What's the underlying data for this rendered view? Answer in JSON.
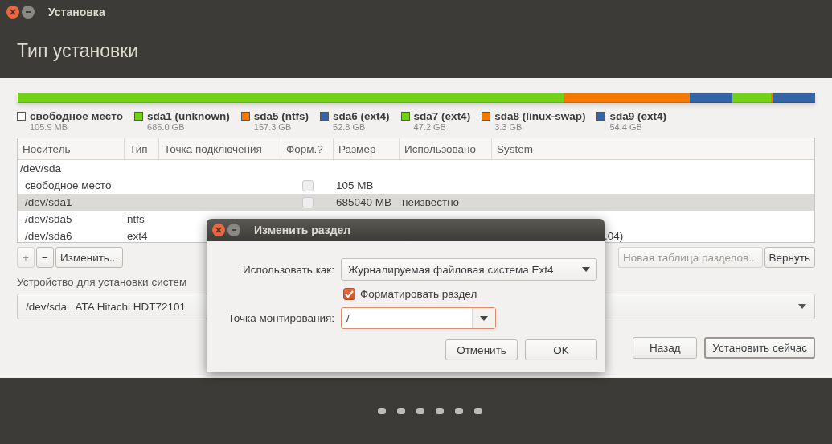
{
  "window": {
    "title": "Установка"
  },
  "page_title": "Тип установки",
  "partitions": [
    {
      "name": "свободное место",
      "size": "105.9 MB",
      "color": "#ffffff"
    },
    {
      "name": "sda1 (unknown)",
      "size": "685.0 GB",
      "color": "#73d216"
    },
    {
      "name": "sda5 (ntfs)",
      "size": "157.3 GB",
      "color": "#f57900"
    },
    {
      "name": "sda6 (ext4)",
      "size": "52.8 GB",
      "color": "#3465a4"
    },
    {
      "name": "sda7 (ext4)",
      "size": "47.2 GB",
      "color": "#73d216"
    },
    {
      "name": "sda8 (linux-swap)",
      "size": "3.3 GB",
      "color": "#f57900"
    },
    {
      "name": "sda9 (ext4)",
      "size": "54.4 GB",
      "color": "#3465a4"
    }
  ],
  "table": {
    "columns": [
      "Носитель",
      "Тип",
      "Точка подключения",
      "Форм.?",
      "Размер",
      "Использовано",
      "System"
    ],
    "rows": [
      {
        "kind": "disk",
        "device": "/dev/sda",
        "selected": false
      },
      {
        "kind": "partition",
        "device": "свободное место",
        "format": false,
        "size": "105 MB",
        "selected": false
      },
      {
        "kind": "partition",
        "device": "/dev/sda1",
        "format": false,
        "size": "685040 MB",
        "used": "неизвестно",
        "selected": true
      },
      {
        "kind": "partition",
        "device": "/dev/sda5",
        "type": "ntfs",
        "selected": false
      },
      {
        "kind": "partition",
        "device": "/dev/sda6",
        "type": "ext4",
        "system": ".04)",
        "selected": false
      }
    ]
  },
  "left_buttons": [
    {
      "label": "+",
      "disabled": true
    },
    {
      "label": "−",
      "disabled": false
    },
    {
      "label": "Изменить...",
      "disabled": false
    }
  ],
  "right_buttons": [
    {
      "label": "Новая таблица разделов...",
      "disabled": true
    },
    {
      "label": "Вернуть",
      "disabled": false
    }
  ],
  "device_label": "Устройство для установки систем",
  "device_combo": {
    "value": "/dev/sda   ATA Hitachi HDT72101"
  },
  "nav_buttons": [
    {
      "label": "Назад",
      "default": false
    },
    {
      "label": "Установить сейчас",
      "default": true
    }
  ],
  "page_dots": [
    {
      "selected": false
    },
    {
      "selected": false
    },
    {
      "selected": false
    },
    {
      "selected": false
    },
    {
      "selected": false
    },
    {
      "selected": false
    }
  ],
  "dialog": {
    "title": "Изменить раздел",
    "use_as_label": "Использовать как:",
    "use_as_value": "Журналируемая файловая система Ext4",
    "format": {
      "label": "Форматировать раздел",
      "checked": true
    },
    "mount_label": "Точка монтирования:",
    "mount_value": "/",
    "buttons": [
      {
        "label": "Отменить"
      },
      {
        "label": "OK"
      }
    ]
  }
}
